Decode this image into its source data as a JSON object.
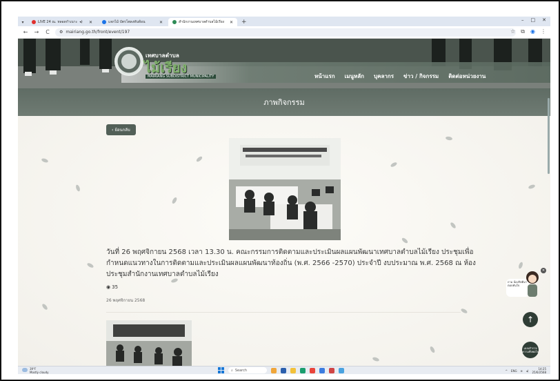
{
  "browser": {
    "tabs": [
      {
        "title": "LIVE 24 ณ. หลอดกำเนาะ",
        "active": false,
        "favicon_color": "#e0302d",
        "audio": true
      },
      {
        "title": "แจกไม้ บัตรโพลงทันท้อน",
        "active": false,
        "favicon_color": "#1a73e8"
      },
      {
        "title": "สำนักงานเทศบาลตำบลไม้เรียง",
        "active": true,
        "favicon_color": "#2e8b57"
      }
    ],
    "new_tab_icon": "plus-icon",
    "url": "mairiang.go.th/front/event/197",
    "window_controls": [
      "–",
      "□",
      "✕"
    ]
  },
  "site": {
    "logo_top_text": "เทศบาลตำบล",
    "logo_name": "ไม้เรียง",
    "logo_sub": "MAIRIANG SUBDISTRICT MUNICIPALITY",
    "menu": [
      "หน้าแรก",
      "เมนูหลัก",
      "บุคลากร",
      "ข่าว / กิจกรรม",
      "ติดต่อหน่วยงาน"
    ],
    "page_title": "ภาพกิจกรรม",
    "accent": "#5f6c64"
  },
  "event": {
    "back_label": "ย้อนกลับ",
    "title": "วันที่ 26 พฤศจิกายน 2568 เวลา 13.30 น. คณะกรรมการติดตามและประเมินผลแผนพัฒนาเทศบาลตำบลไม้เรียง ประชุมเพื่อกำหนดแนวทางในการติดตามและประเมินผลแผนพัฒนาท้องถิ่น (พ.ศ. 2566 -2570) ประจำปี งบประมาณ พ.ศ. 2568 ณ ห้องประชุมสำนักงานเทศบาลตำบลไม้เรียง",
    "views": "35",
    "date": "26 พฤศจิกายน 2568"
  },
  "widgets": {
    "chat_text": "ถาม น้องกิตติมา ตอบทันใจ",
    "up_icon": "arrow-up-icon",
    "survey_text": "แบบสำรวจความพึงพอใจ"
  },
  "taskbar": {
    "temperature": "39°F",
    "weather": "Mostly cloudy",
    "search_placeholder": "Search",
    "lang": "ENG",
    "time": "14:25",
    "date": "25/6/2568"
  }
}
